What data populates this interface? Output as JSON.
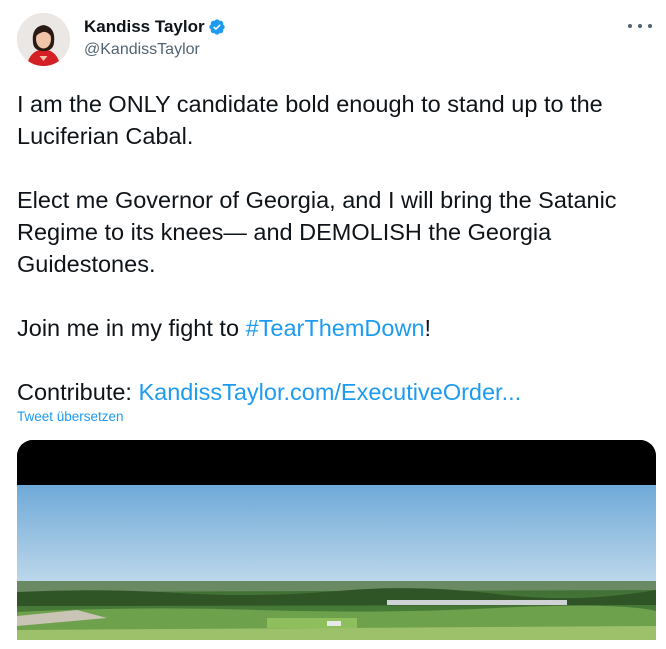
{
  "author": {
    "display_name": "Kandiss Taylor",
    "handle": "@KandissTaylor",
    "verified_icon": "verified-badge-icon",
    "avatar_icon": "avatar-photo"
  },
  "more_icon": "more-options-icon",
  "tweet": {
    "line1": "I am the ONLY candidate bold enough to stand up to the Luciferian Cabal.",
    "line2": "Elect me Governor of Georgia, and I will bring the Satanic Regime to its knees— and DEMOLISH the Georgia Guidestones.",
    "line3_prefix": "Join me in my fight to ",
    "hashtag": "#TearThemDown",
    "line3_suffix": "!",
    "contribute_prefix": "Contribute: ",
    "contribute_link": "KandissTaylor.com/ExecutiveOrder..."
  },
  "translate_label": "Tweet übersetzen",
  "media": {
    "type": "video-thumbnail",
    "subject": "aerial-landscape"
  },
  "colors": {
    "accent": "#1d9bf0",
    "text": "#0f1419",
    "secondary_text": "#536471"
  }
}
